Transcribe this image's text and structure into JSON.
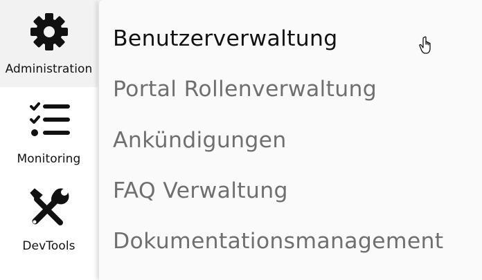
{
  "sidebar": {
    "items": [
      {
        "label": "Administration",
        "icon": "gear-icon",
        "active": true
      },
      {
        "label": "Monitoring",
        "icon": "checklist-icon",
        "active": false
      },
      {
        "label": "DevTools",
        "icon": "tools-icon",
        "active": false
      }
    ]
  },
  "menu": {
    "items": [
      {
        "label": "Benutzerverwaltung",
        "active": true
      },
      {
        "label": "Portal Rollenverwaltung",
        "active": false
      },
      {
        "label": "Ankündigungen",
        "active": false
      },
      {
        "label": "FAQ Verwaltung",
        "active": false
      },
      {
        "label": "Dokumentationsmanagement",
        "active": false
      }
    ]
  },
  "colors": {
    "active_text": "#111111",
    "inactive_text": "#6f6f6f",
    "active_nav_bg": "#f2f2f2",
    "flyout_bg": "#fafafa"
  }
}
